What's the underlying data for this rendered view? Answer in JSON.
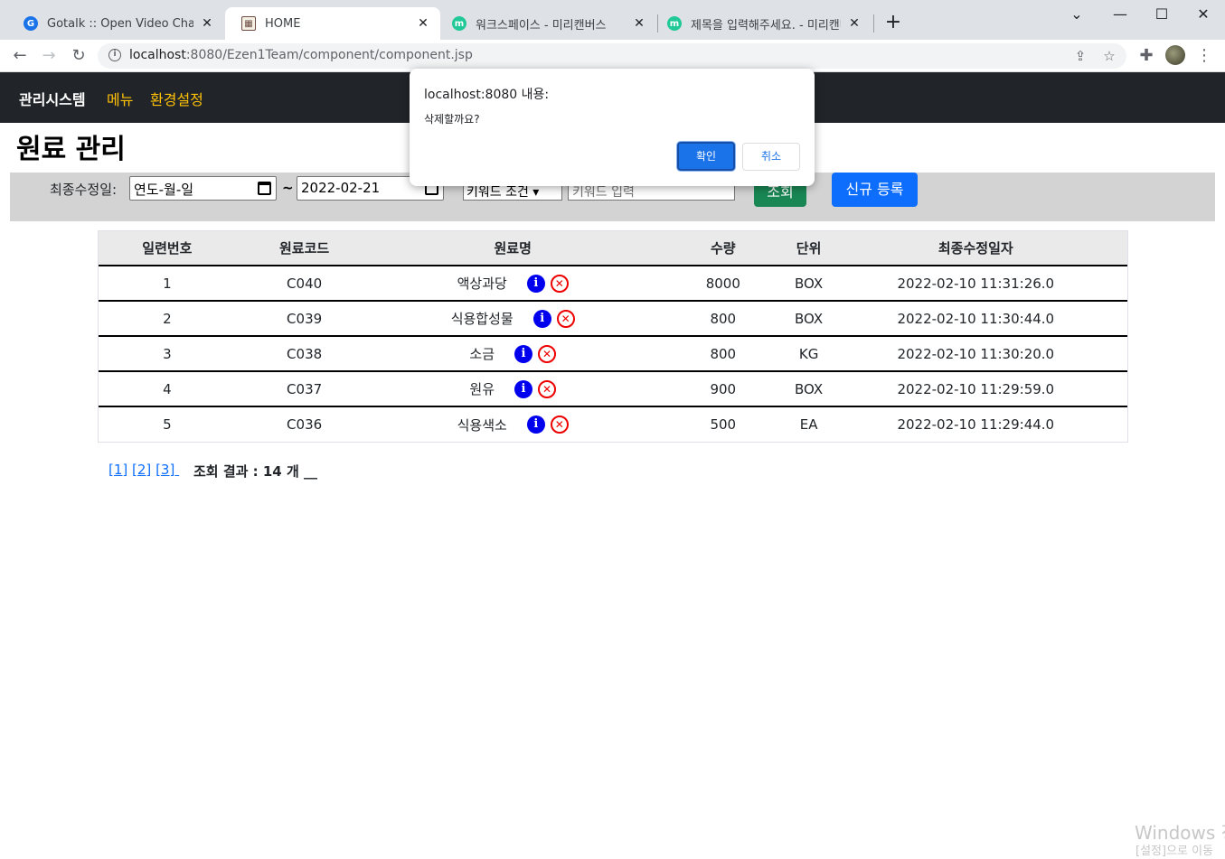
{
  "browser": {
    "tabs": [
      {
        "title": "Gotalk :: Open Video Chat",
        "favicon": "gotalk-icon",
        "color": "#1a73e8"
      },
      {
        "title": "HOME",
        "favicon": "image-icon",
        "color": "#6d4c41"
      },
      {
        "title": "워크스페이스 - 미리캔버스",
        "favicon": "miricanvas-icon",
        "color": "#20c997"
      },
      {
        "title": "제목을 입력해주세요. - 미리캔버",
        "favicon": "miricanvas-icon",
        "color": "#20c997"
      }
    ],
    "url_host": "localhost",
    "url_rest": ":8080/Ezen1Team/component/component.jsp"
  },
  "navbar": {
    "brand": "관리시스템",
    "links": [
      "메뉴",
      "환경설정"
    ]
  },
  "page": {
    "title": "원료 관리"
  },
  "filter": {
    "label": "최종수정일:",
    "date_from": "연도-월-일",
    "tilde": "~",
    "date_to": "2022-02-21",
    "select_value": "키워드 조건",
    "keyword_placeholder": "키워드 입력",
    "search_button": "조회",
    "new_button": "신규 등록"
  },
  "table": {
    "headers": [
      "일련번호",
      "원료코드",
      "원료명",
      "수량",
      "단위",
      "최종수정일자"
    ],
    "rows": [
      [
        "1",
        "C040",
        "액상과당",
        "8000",
        "BOX",
        "2022-02-10 11:31:26.0"
      ],
      [
        "2",
        "C039",
        "식용합성물",
        "800",
        "BOX",
        "2022-02-10 11:30:44.0"
      ],
      [
        "3",
        "C038",
        "소금",
        "800",
        "KG",
        "2022-02-10 11:30:20.0"
      ],
      [
        "4",
        "C037",
        "원유",
        "900",
        "BOX",
        "2022-02-10 11:29:59.0"
      ],
      [
        "5",
        "C036",
        "식용색소",
        "500",
        "EA",
        "2022-02-10 11:29:44.0"
      ]
    ]
  },
  "pagination": {
    "pages": [
      "[1]",
      "[2]",
      "[3]"
    ],
    "result_text": "조회 결과 : 14 개 __"
  },
  "dialog": {
    "title": "localhost:8080 내용:",
    "message": "삭제할까요?",
    "ok": "확인",
    "cancel": "취소"
  },
  "watermark": {
    "line1": "Windows 정",
    "line2": "[설정]으로 이동"
  },
  "colors": {
    "navbar": "#212529",
    "nav_link": "#ffc107",
    "success": "#198754",
    "primary": "#0d6efd",
    "dialog_ok": "#1a73e8"
  }
}
